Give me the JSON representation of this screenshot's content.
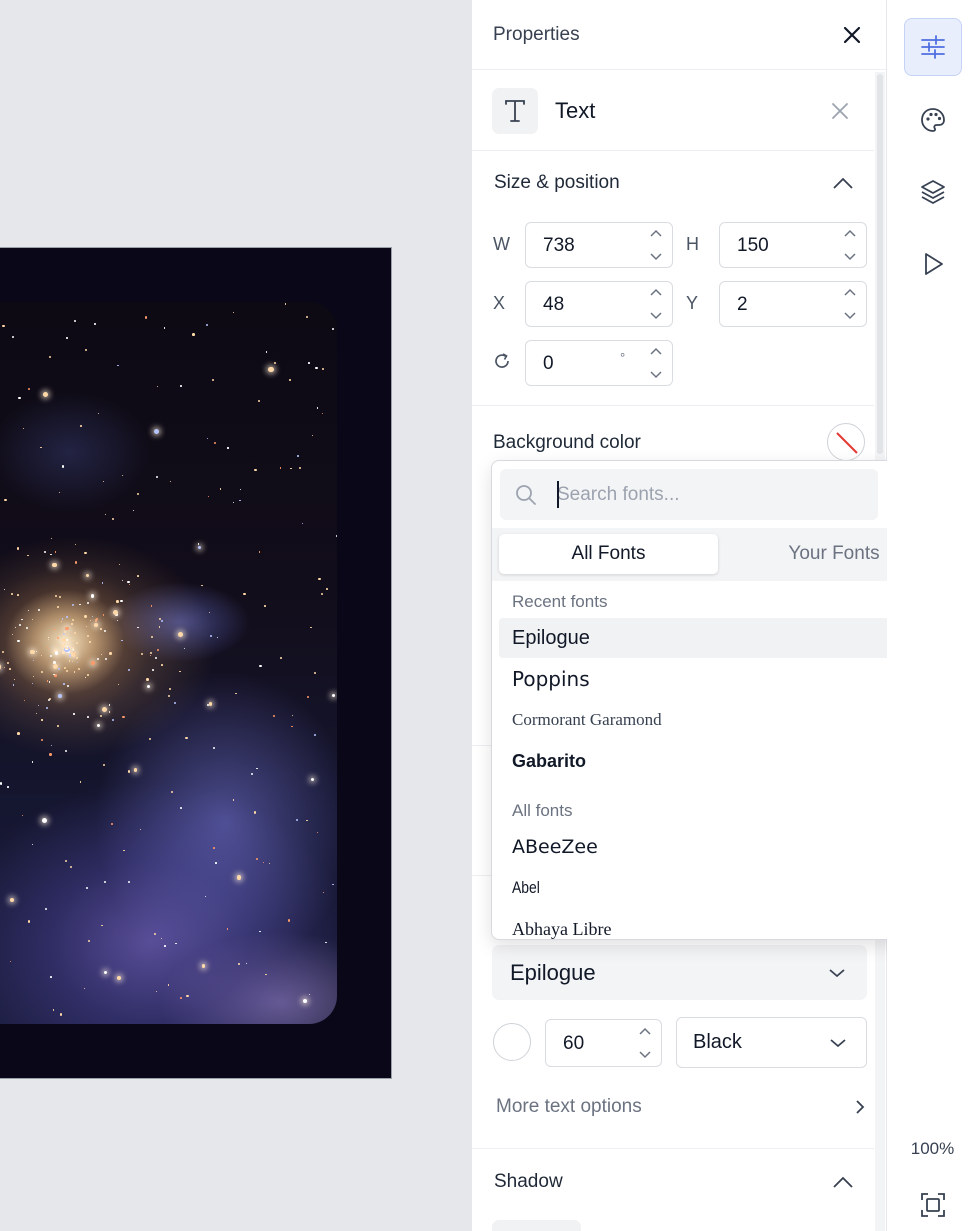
{
  "panel": {
    "title": "Properties",
    "element_label": "Text"
  },
  "size_position": {
    "title": "Size & position",
    "w_label": "W",
    "w_value": "738",
    "h_label": "H",
    "h_value": "150",
    "x_label": "X",
    "x_value": "48",
    "y_label": "Y",
    "y_value": "2",
    "rotation_value": "0",
    "rotation_unit": "°"
  },
  "background": {
    "title": "Background color"
  },
  "font_dropdown": {
    "search_placeholder": "Search fonts...",
    "tabs": [
      "All Fonts",
      "Your Fonts"
    ],
    "recent_title": "Recent fonts",
    "recent": [
      "Epilogue",
      "Poppins",
      "Cormorant Garamond",
      "Gabarito"
    ],
    "selected": "Epilogue",
    "all_title": "All fonts",
    "all": [
      "ABeeZee",
      "Abel",
      "Abhaya Libre"
    ]
  },
  "text_style": {
    "font_family": "Epilogue",
    "font_size": "60",
    "font_weight": "Black",
    "more_options": "More text options"
  },
  "shadow": {
    "title": "Shadow"
  },
  "toolbar": {
    "zoom": "100%"
  },
  "colors": {
    "accent": "#4f6fe0",
    "artboard_bg": "#0a0818",
    "none_slash": "#e53935"
  }
}
